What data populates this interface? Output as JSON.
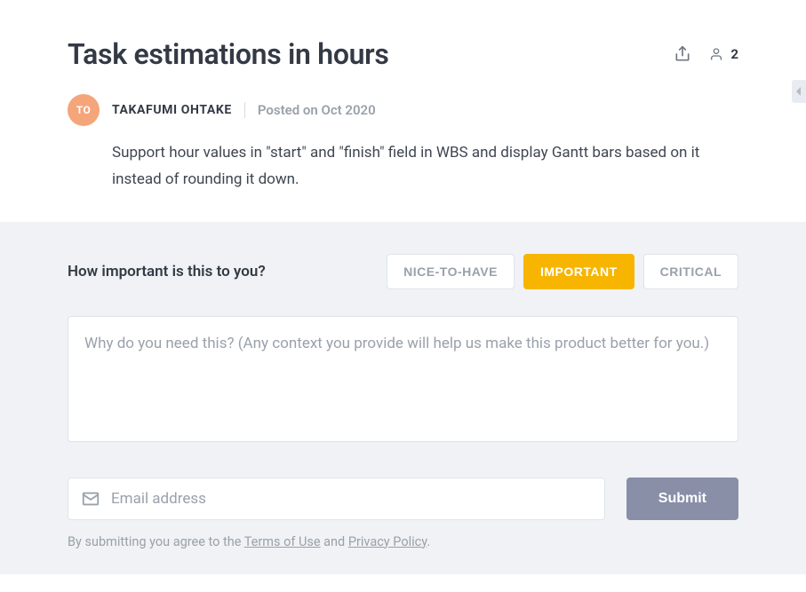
{
  "header": {
    "title": "Task estimations in hours",
    "vote_count": "2"
  },
  "post": {
    "avatar_initials": "TO",
    "author": "TAKAFUMI OHTAKE",
    "posted": "Posted on Oct 2020",
    "description": "Support hour values in \"start\" and \"finish\" field in WBS and display Gantt bars based on it instead of rounding it down."
  },
  "feedback": {
    "importance_label": "How important is this to you?",
    "options": {
      "nice": "NICE-TO-HAVE",
      "important": "IMPORTANT",
      "critical": "CRITICAL"
    },
    "reason_placeholder": "Why do you need this? (Any context you provide will help us make this product better for you.)",
    "email_placeholder": "Email address",
    "submit_label": "Submit",
    "terms_prefix": "By submitting you agree to the ",
    "terms_of_use": "Terms of Use",
    "terms_and": " and ",
    "privacy_policy": "Privacy Policy",
    "terms_suffix": "."
  }
}
